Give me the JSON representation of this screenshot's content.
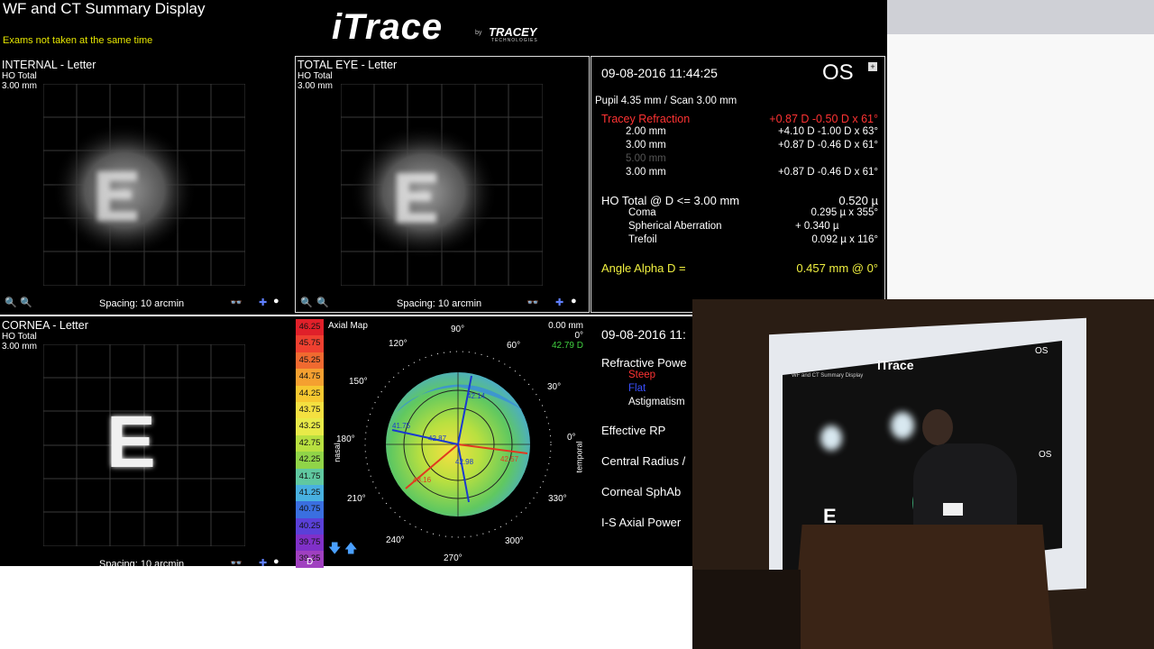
{
  "header": {
    "title": "WF and CT Summary Display",
    "notice": "Exams not taken at the same time",
    "logo": "iTrace",
    "logo_by": "by",
    "logo_brand": "TRACEY",
    "logo_sub": "TECHNOLOGIES"
  },
  "panels": {
    "internal": {
      "title": "INTERNAL - Letter",
      "sub1": "HO Total",
      "sub2": "3.00 mm",
      "spacing": "Spacing:  10 arcmin"
    },
    "total": {
      "title": "TOTAL EYE - Letter",
      "sub1": "HO Total",
      "sub2": "3.00 mm",
      "spacing": "Spacing:  10 arcmin"
    },
    "cornea": {
      "title": "CORNEA - Letter",
      "sub1": "HO Total",
      "sub2": "3.00 mm",
      "spacing": "Spacing:  10 arcmin",
      "letter": "E"
    }
  },
  "wf_info": {
    "datetime": "09-08-2016  11:44:25",
    "eye": "OS",
    "pupil_scan": "Pupil 4.35 mm  /  Scan 3.00 mm",
    "refraction_label": "Tracey Refraction",
    "refraction_value": "+0.87 D -0.50 D x 61°",
    "rows": [
      {
        "label": "2.00 mm",
        "value": "+4.10 D -1.00 D x 63°"
      },
      {
        "label": "3.00 mm",
        "value": "+0.87 D -0.46 D x 61°"
      },
      {
        "label": "5.00 mm",
        "value": ""
      },
      {
        "label": "3.00 mm",
        "value": "+0.87 D -0.46 D x 61°"
      }
    ],
    "ho_label": "HO Total @ D <= 3.00 mm",
    "ho_value": "0.520 µ",
    "coma_label": "Coma",
    "coma_value": "0.295 µ x 355°",
    "sph_label": "Spherical Aberration",
    "sph_value": "+ 0.340 µ",
    "tref_label": "Trefoil",
    "tref_value": "0.092 µ x 116°",
    "alpha_label": "Angle Alpha  D =",
    "alpha_value": "0.457 mm @ 0°"
  },
  "map": {
    "title": "Axial Map",
    "top_right": "0.00 mm",
    "top_right2": "0°",
    "top_right3": "42.79 D",
    "scale": [
      "46.25",
      "45.75",
      "45.25",
      "44.75",
      "44.25",
      "43.75",
      "43.25",
      "42.75",
      "42.25",
      "41.75",
      "41.25",
      "40.75",
      "40.25",
      "39.75",
      "39.25"
    ],
    "scale_colors": [
      "#e0202a",
      "#ef4030",
      "#f06a30",
      "#f5a030",
      "#f7c830",
      "#f4e040",
      "#e8ea48",
      "#b8e040",
      "#90d448",
      "#60c8a0",
      "#48b0e0",
      "#3a6fe0",
      "#5a40d8",
      "#8030c8",
      "#a040c0"
    ],
    "scale_unit": "D",
    "degrees": [
      "90°",
      "60°",
      "30°",
      "0°",
      "330°",
      "300°",
      "270°",
      "240°",
      "210°",
      "180°",
      "150°",
      "120°"
    ],
    "nasal": "nasal",
    "temporal": "temporal",
    "steep_values": [
      "42.57",
      "43.16",
      "42.98"
    ],
    "flat_values": [
      "41.75",
      "42.87",
      "42.14"
    ]
  },
  "ct_info": {
    "datetime": "09-08-2016  11:",
    "refractive_power": "Refractive Powe",
    "steep": "Steep",
    "flat": "Flat",
    "astigmatism": "Astigmatism",
    "effective_rp": "Effective RP",
    "central_radius": "Central Radius /",
    "corneal_sphab": "Corneal SphAb",
    "is_axial": "I-S Axial Power"
  },
  "photo": {
    "slide_title": "WF and CT Summary Display",
    "slide_logo": "iTrace",
    "slide_eye": "OS",
    "slide_eye2": "OS",
    "slide_letter": "E"
  },
  "colors": {
    "accent_red": "#ff3333",
    "accent_yellow": "#f0f040",
    "panel_bg": "#000000"
  }
}
